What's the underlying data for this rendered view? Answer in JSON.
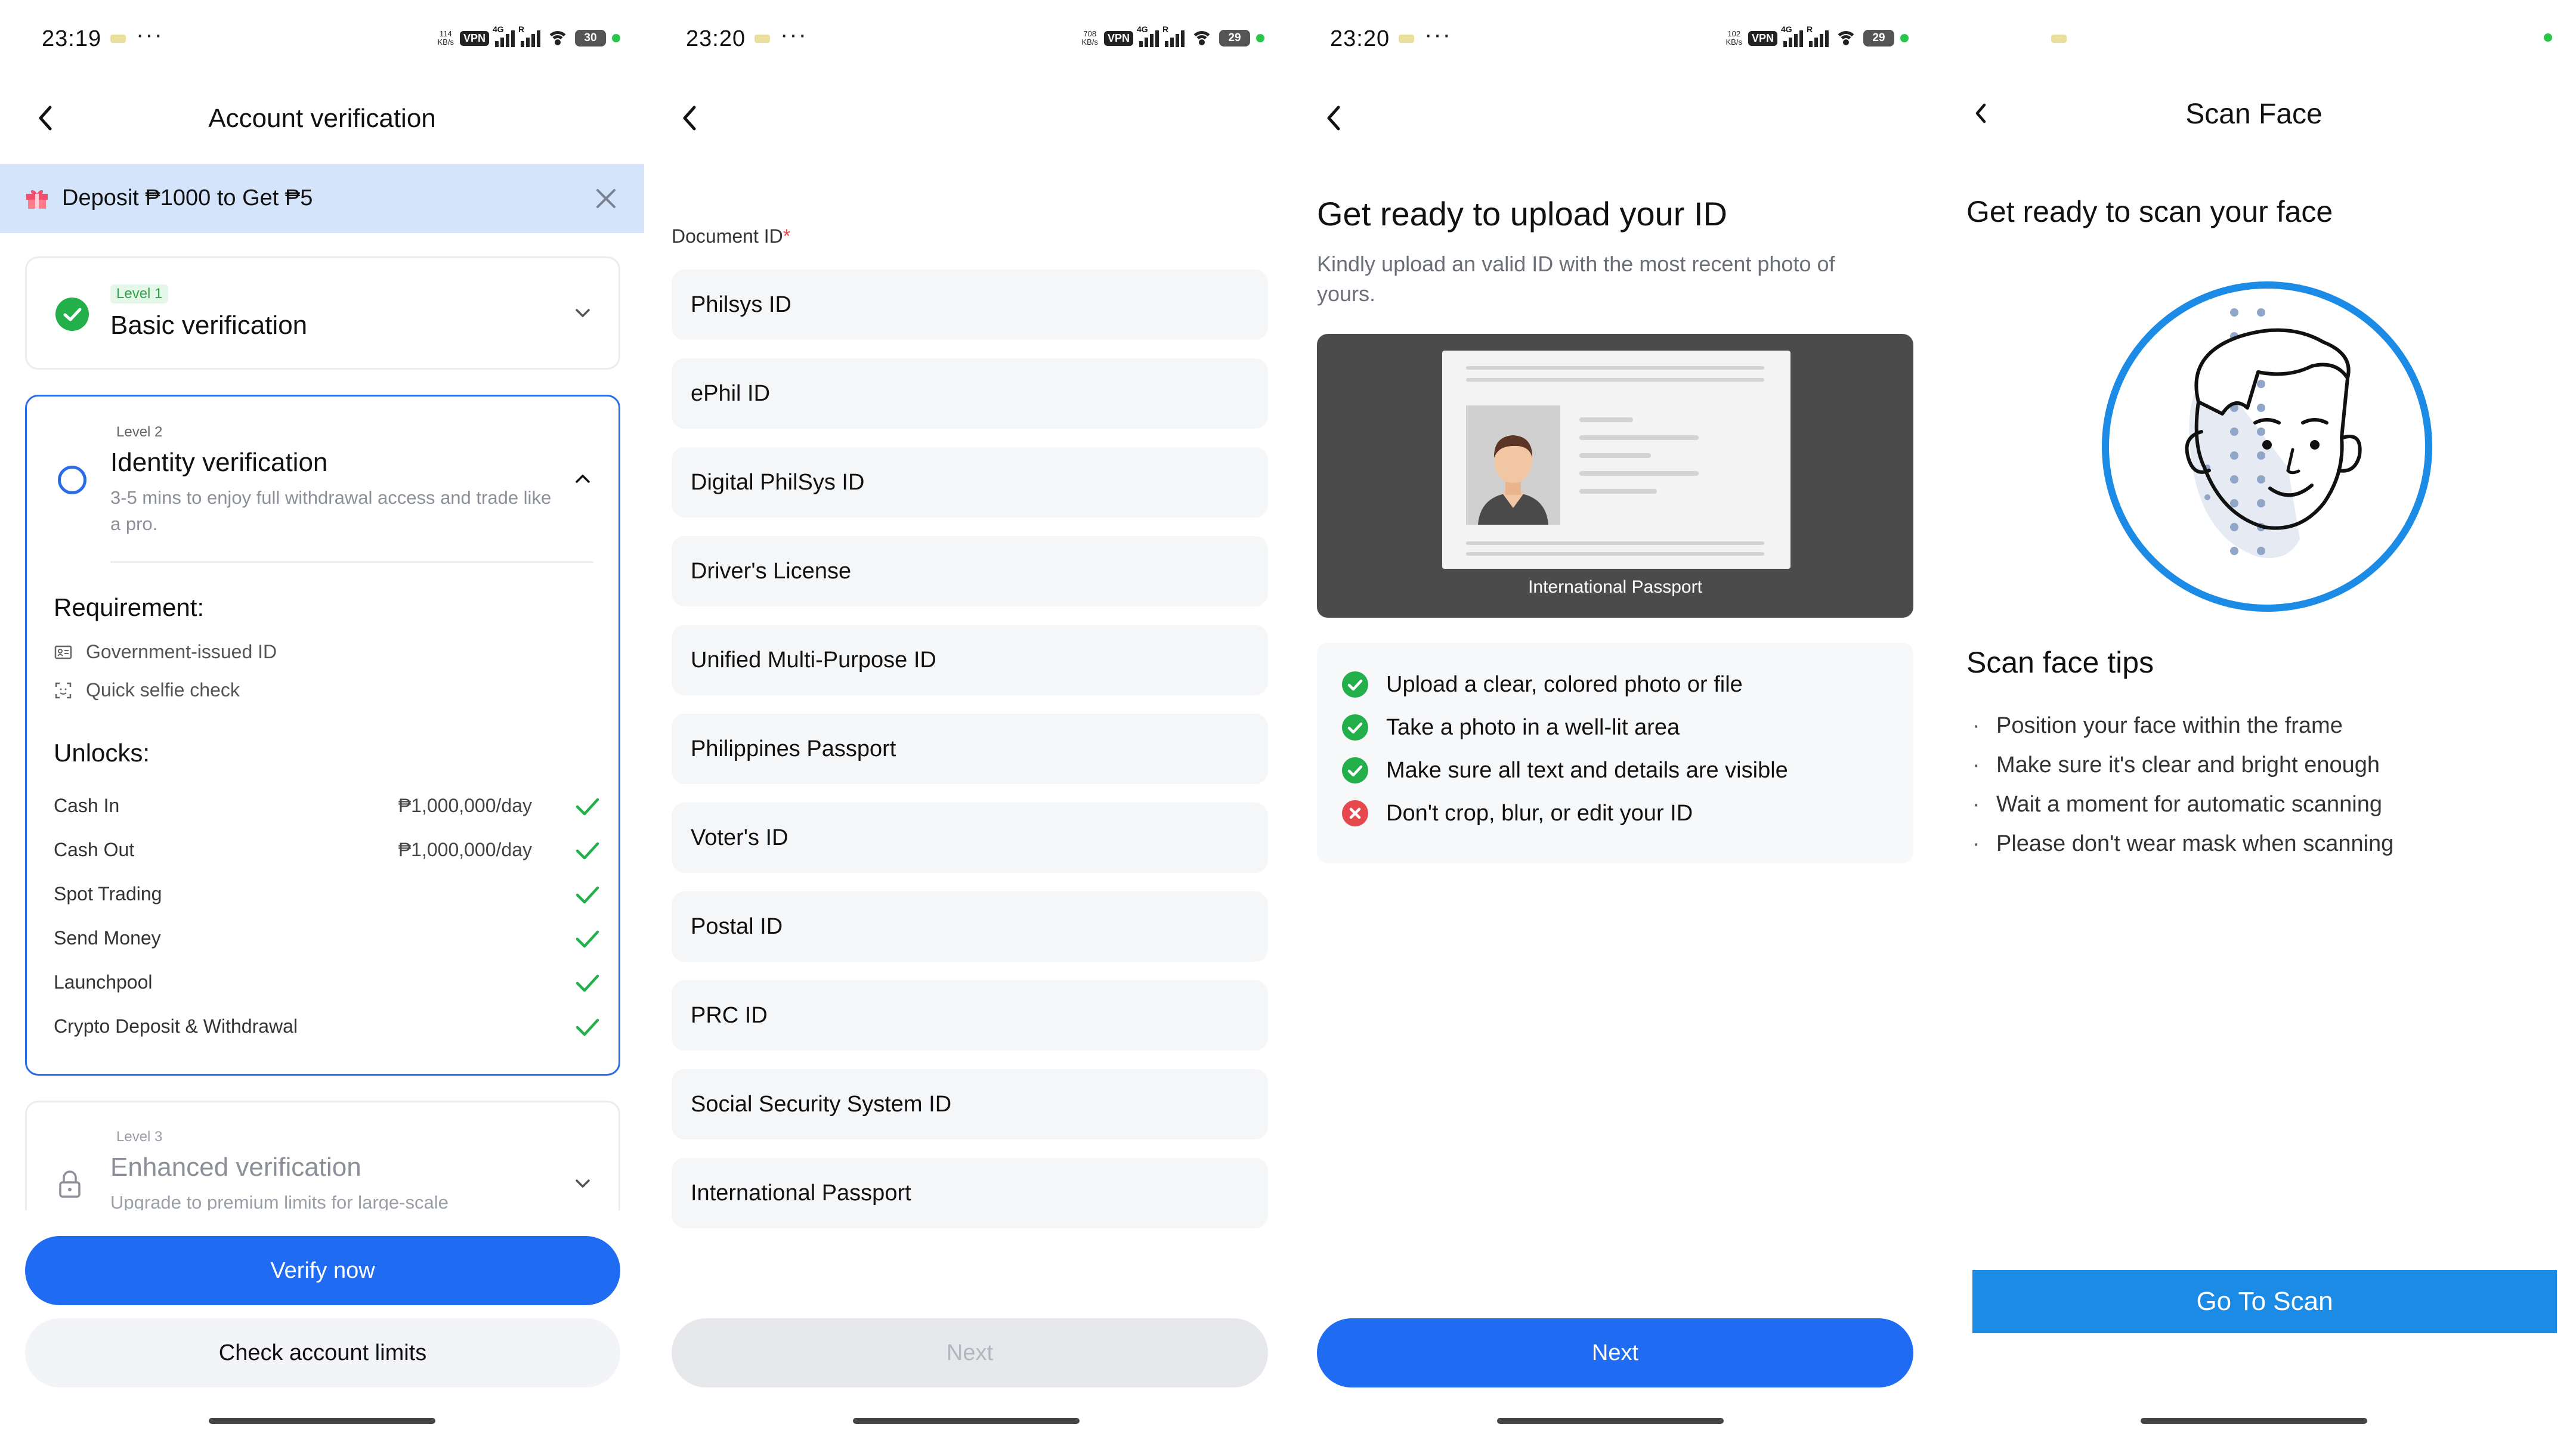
{
  "screen1": {
    "status": {
      "time": "23:19",
      "speed_top": "114",
      "speed_unit": "KB/s",
      "vpn": "VPN",
      "net": "4G",
      "roam": "R",
      "battery": "30"
    },
    "header": {
      "title": "Account verification"
    },
    "promo": {
      "text": "Deposit ₱1000 to Get ₱5"
    },
    "level1": {
      "chip": "Level 1",
      "title": "Basic verification"
    },
    "level2": {
      "chip": "Level 2",
      "title": "Identity verification",
      "subtitle": "3-5 mins to enjoy full withdrawal access and trade like a pro.",
      "requirement_heading": "Requirement:",
      "requirements": [
        "Government-issued ID",
        "Quick selfie check"
      ],
      "unlocks_heading": "Unlocks:",
      "unlocks": [
        {
          "name": "Cash In",
          "value": "₱1,000,000/day"
        },
        {
          "name": "Cash Out",
          "value": "₱1,000,000/day"
        },
        {
          "name": "Spot Trading",
          "value": ""
        },
        {
          "name": "Send Money",
          "value": ""
        },
        {
          "name": "Launchpool",
          "value": ""
        },
        {
          "name": "Crypto Deposit & Withdrawal",
          "value": ""
        }
      ]
    },
    "level3": {
      "chip": "Level 3",
      "title": "Enhanced verification",
      "subtitle": "Upgrade to premium limits for large-scale"
    },
    "buttons": {
      "verify": "Verify now",
      "limits": "Check account limits"
    }
  },
  "screen2": {
    "status": {
      "time": "23:20",
      "speed_top": "708",
      "speed_unit": "KB/s",
      "vpn": "VPN",
      "net": "4G",
      "roam": "R",
      "battery": "29"
    },
    "label": "Document ID",
    "required_mark": "*",
    "documents": [
      "Philsys ID",
      "ePhil ID",
      "Digital PhilSys ID",
      "Driver's License",
      "Unified Multi-Purpose ID",
      "Philippines Passport",
      "Voter's ID",
      "Postal ID",
      "PRC ID",
      "Social Security System ID",
      "International Passport"
    ],
    "next": "Next"
  },
  "screen3": {
    "status": {
      "time": "23:20",
      "speed_top": "102",
      "speed_unit": "KB/s",
      "vpn": "VPN",
      "net": "4G",
      "roam": "R",
      "battery": "29"
    },
    "title": "Get ready to upload your ID",
    "subtitle": "Kindly upload an valid ID with the most recent photo of yours.",
    "caption": "International Passport",
    "tips": [
      {
        "text": "Upload a clear, colored photo or file",
        "ok": true
      },
      {
        "text": "Take a photo in a well-lit area",
        "ok": true
      },
      {
        "text": "Make sure all text and details are visible",
        "ok": true
      },
      {
        "text": "Don't crop, blur, or edit your ID",
        "ok": false
      }
    ],
    "next": "Next"
  },
  "screen4": {
    "header": {
      "title": "Scan Face"
    },
    "title": "Get ready to scan your face",
    "tips_heading": "Scan face tips",
    "tips": [
      "Position your face within the frame",
      "Make sure it's clear and bright enough",
      "Wait a moment for automatic scanning",
      "Please don't wear mask when scanning"
    ],
    "bullet": "·",
    "button": "Go To Scan"
  },
  "colors": {
    "primary": "#1f6cf2",
    "scan_blue": "#1b8be6",
    "success": "#23b04b",
    "error": "#e5484d",
    "promo_bg": "#d4e4fb"
  }
}
